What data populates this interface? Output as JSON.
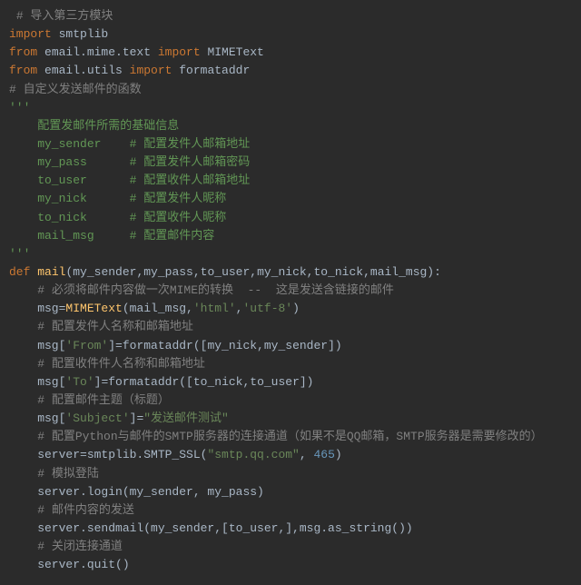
{
  "lines": [
    [
      [
        " ",
        " "
      ],
      [
        "# 导入第三方模块",
        "cm"
      ]
    ],
    [
      [
        "import ",
        "kw"
      ],
      [
        "smtplib",
        "id"
      ]
    ],
    [
      [
        "from ",
        "kw"
      ],
      [
        "email.mime.text ",
        "id"
      ],
      [
        "import ",
        "kw"
      ],
      [
        "MIMEText",
        "id"
      ]
    ],
    [
      [
        "from ",
        "kw"
      ],
      [
        "email.utils ",
        "id"
      ],
      [
        "import ",
        "kw"
      ],
      [
        "formataddr",
        "id"
      ]
    ],
    [
      [
        "",
        ""
      ]
    ],
    [
      [
        "# 自定义发送邮件的函数",
        "cm"
      ]
    ],
    [
      [
        "'''",
        "doc"
      ]
    ],
    [
      [
        "    配置发邮件所需的基础信息",
        "doc"
      ]
    ],
    [
      [
        "    my_sender    # 配置发件人邮箱地址",
        "doc"
      ]
    ],
    [
      [
        "    my_pass      # 配置发件人邮箱密码",
        "doc"
      ]
    ],
    [
      [
        "    to_user      # 配置收件人邮箱地址",
        "doc"
      ]
    ],
    [
      [
        "    my_nick      # 配置发件人昵称",
        "doc"
      ]
    ],
    [
      [
        "    to_nick      # 配置收件人昵称",
        "doc"
      ]
    ],
    [
      [
        "    mail_msg     # 配置邮件内容",
        "doc"
      ]
    ],
    [
      [
        "'''",
        "doc"
      ]
    ],
    [
      [
        "def ",
        "kw"
      ],
      [
        "mail",
        "fn"
      ],
      [
        "(my_sender,my_pass,to_user,my_nick,to_nick,mail_msg):",
        "id"
      ]
    ],
    [
      [
        "    ",
        ""
      ],
      [
        "# 必须将邮件内容做一次MIME的转换  --  这是发送含链接的邮件",
        "cm"
      ]
    ],
    [
      [
        "    msg=",
        "id"
      ],
      [
        "MIMEText",
        "fn"
      ],
      [
        "(mail_msg,",
        "id"
      ],
      [
        "'html'",
        "str"
      ],
      [
        ",",
        "id"
      ],
      [
        "'utf-8'",
        "str"
      ],
      [
        ")",
        "id"
      ]
    ],
    [
      [
        "    ",
        ""
      ],
      [
        "# 配置发件人名称和邮箱地址",
        "cm"
      ]
    ],
    [
      [
        "    msg[",
        "id"
      ],
      [
        "'From'",
        "str"
      ],
      [
        "]=formataddr([my_nick,my_sender])",
        "id"
      ]
    ],
    [
      [
        "    ",
        ""
      ],
      [
        "# 配置收件件人名称和邮箱地址",
        "cm"
      ]
    ],
    [
      [
        "    msg[",
        "id"
      ],
      [
        "'To'",
        "str"
      ],
      [
        "]=formataddr([to_nick,to_user])",
        "id"
      ]
    ],
    [
      [
        "    ",
        ""
      ],
      [
        "# 配置邮件主题（标题）",
        "cm"
      ]
    ],
    [
      [
        "    msg[",
        "id"
      ],
      [
        "'Subject'",
        "str"
      ],
      [
        "]=",
        "id"
      ],
      [
        "\"发送邮件测试\"",
        "str"
      ]
    ],
    [
      [
        "    ",
        ""
      ],
      [
        "# 配置Python与邮件的SMTP服务器的连接通道（如果不是QQ邮箱，SMTP服务器是需要修改的）",
        "cm"
      ]
    ],
    [
      [
        "    server=smtplib.SMTP_SSL(",
        "id"
      ],
      [
        "\"smtp.qq.com\"",
        "str"
      ],
      [
        ", ",
        "id"
      ],
      [
        "465",
        "num"
      ],
      [
        ")",
        "id"
      ]
    ],
    [
      [
        "    ",
        ""
      ],
      [
        "# 模拟登陆",
        "cm"
      ]
    ],
    [
      [
        "    server.login(my_sender, my_pass)",
        "id"
      ]
    ],
    [
      [
        "    ",
        ""
      ],
      [
        "# 邮件内容的发送",
        "cm"
      ]
    ],
    [
      [
        "    server.sendmail(my_sender,[to_user,],msg.as_string())",
        "id"
      ]
    ],
    [
      [
        "    ",
        ""
      ],
      [
        "# 关闭连接通道",
        "cm"
      ]
    ],
    [
      [
        "    server.quit()",
        "id"
      ]
    ]
  ]
}
